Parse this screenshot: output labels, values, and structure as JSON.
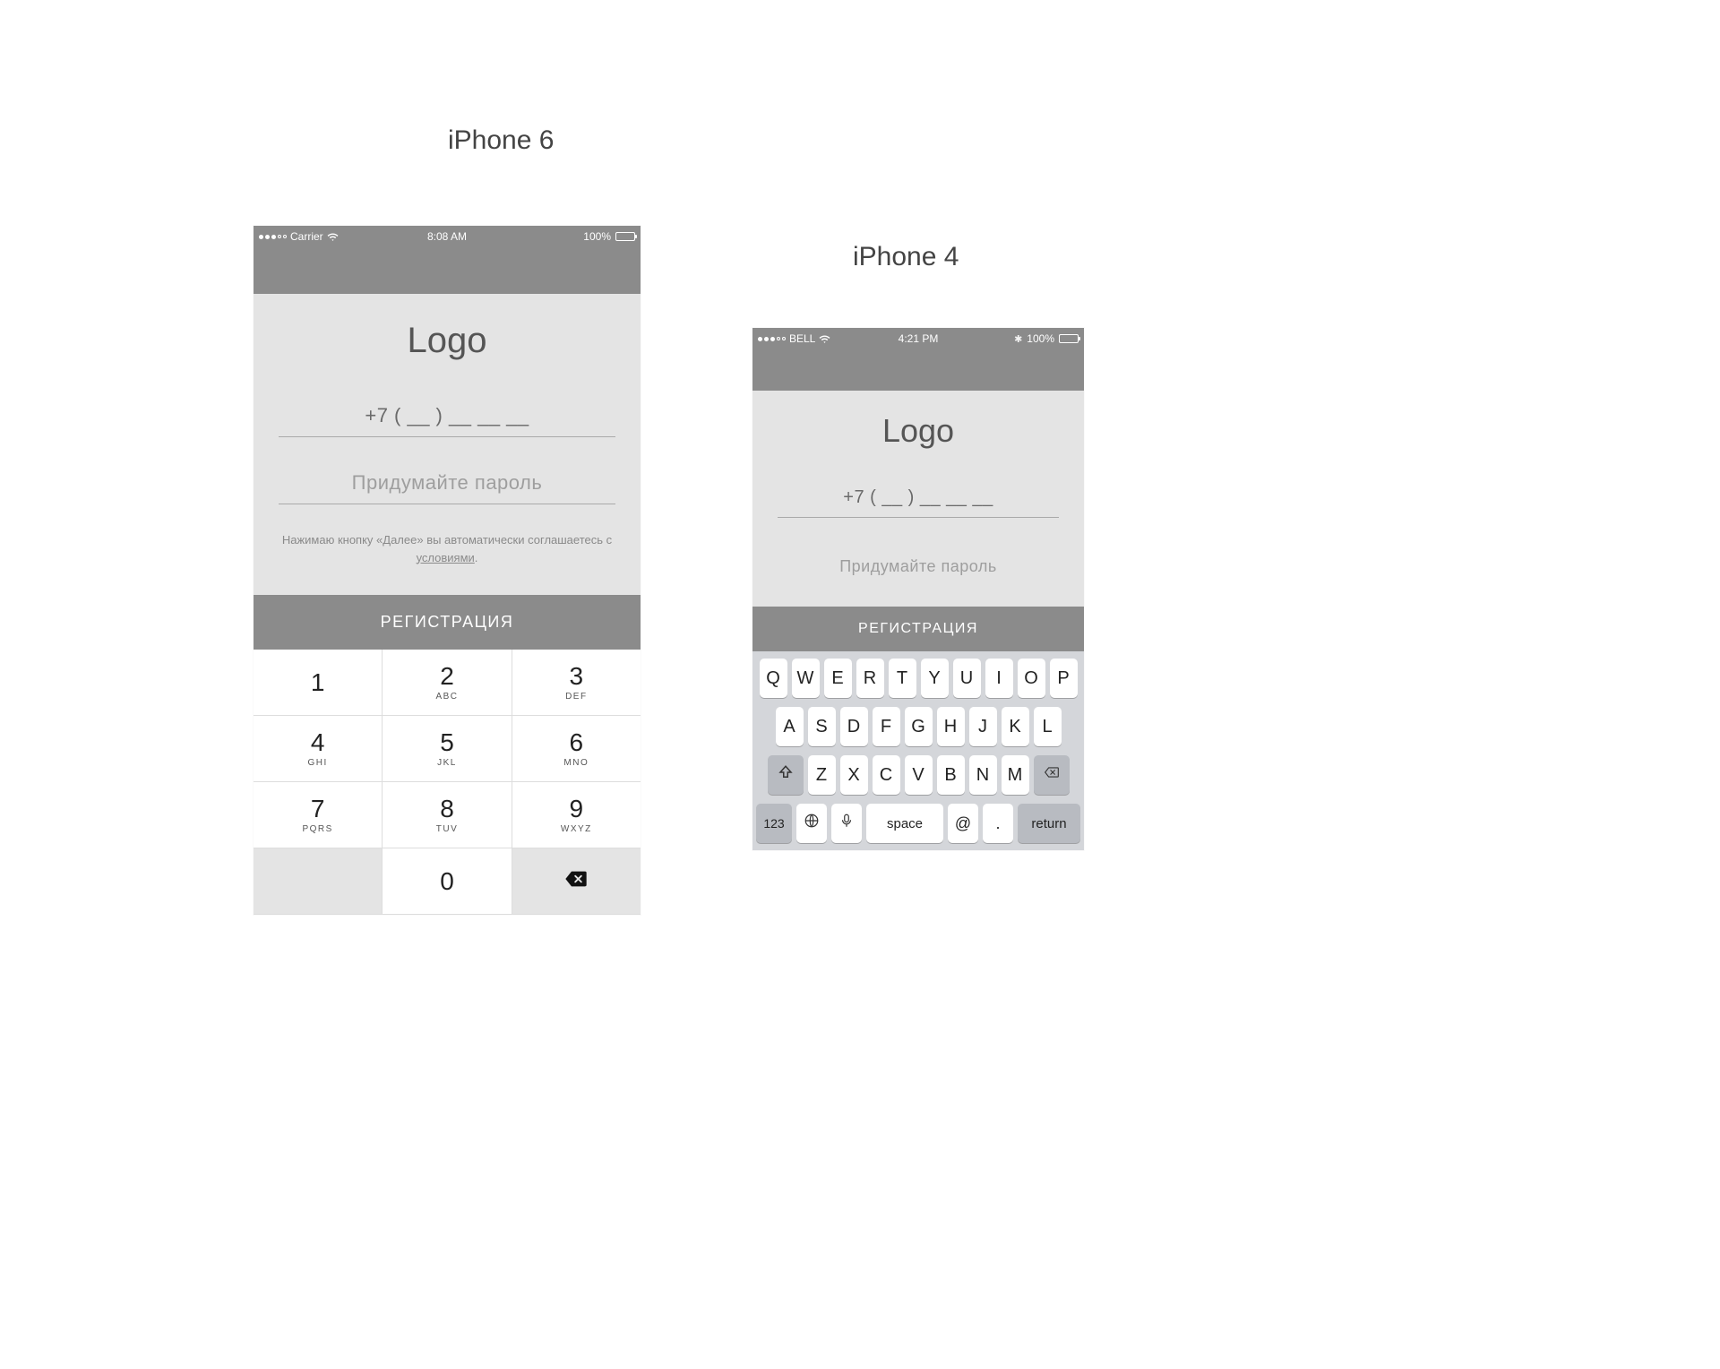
{
  "labels": {
    "iphone6": "iPhone 6",
    "iphone4": "iPhone 4"
  },
  "common": {
    "logo": "Logo",
    "phone_mask": "+7 ( __ ) __ __ __",
    "password_placeholder": "Придумайте пароль",
    "register_button": "РЕГИСТРАЦИЯ"
  },
  "iphone6": {
    "status": {
      "carrier": "Carrier",
      "time": "8:08 AM",
      "battery": "100%"
    },
    "terms": {
      "prefix": "Нажимаю кнопку «Далее» вы автоматически соглашаетесь с ",
      "link": "условиями",
      "suffix": "."
    },
    "keypad": {
      "rows": [
        [
          {
            "num": "1",
            "sub": ""
          },
          {
            "num": "2",
            "sub": "ABC"
          },
          {
            "num": "3",
            "sub": "DEF"
          }
        ],
        [
          {
            "num": "4",
            "sub": "GHI"
          },
          {
            "num": "5",
            "sub": "JKL"
          },
          {
            "num": "6",
            "sub": "MNO"
          }
        ],
        [
          {
            "num": "7",
            "sub": "PQRS"
          },
          {
            "num": "8",
            "sub": "TUV"
          },
          {
            "num": "9",
            "sub": "WXYZ"
          }
        ]
      ],
      "zero": "0"
    }
  },
  "iphone4": {
    "status": {
      "carrier": "BELL",
      "time": "4:21 PM",
      "battery": "100%"
    },
    "qwerty": {
      "row1": [
        "Q",
        "W",
        "E",
        "R",
        "T",
        "Y",
        "U",
        "I",
        "O",
        "P"
      ],
      "row2": [
        "A",
        "S",
        "D",
        "F",
        "G",
        "H",
        "J",
        "K",
        "L"
      ],
      "row3": [
        "Z",
        "X",
        "C",
        "V",
        "B",
        "N",
        "M"
      ],
      "num_switch": "123",
      "space": "space",
      "at": "@",
      "dot": ".",
      "return": "return"
    }
  }
}
